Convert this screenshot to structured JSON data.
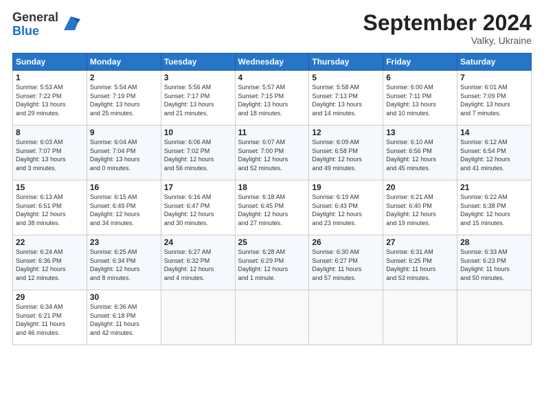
{
  "header": {
    "logo_general": "General",
    "logo_blue": "Blue",
    "month_title": "September 2024",
    "location": "Valky, Ukraine"
  },
  "days_of_week": [
    "Sunday",
    "Monday",
    "Tuesday",
    "Wednesday",
    "Thursday",
    "Friday",
    "Saturday"
  ],
  "weeks": [
    [
      {
        "day": "1",
        "info": "Sunrise: 5:53 AM\nSunset: 7:22 PM\nDaylight: 13 hours\nand 29 minutes."
      },
      {
        "day": "2",
        "info": "Sunrise: 5:54 AM\nSunset: 7:19 PM\nDaylight: 13 hours\nand 25 minutes."
      },
      {
        "day": "3",
        "info": "Sunrise: 5:56 AM\nSunset: 7:17 PM\nDaylight: 13 hours\nand 21 minutes."
      },
      {
        "day": "4",
        "info": "Sunrise: 5:57 AM\nSunset: 7:15 PM\nDaylight: 13 hours\nand 18 minutes."
      },
      {
        "day": "5",
        "info": "Sunrise: 5:58 AM\nSunset: 7:13 PM\nDaylight: 13 hours\nand 14 minutes."
      },
      {
        "day": "6",
        "info": "Sunrise: 6:00 AM\nSunset: 7:11 PM\nDaylight: 13 hours\nand 10 minutes."
      },
      {
        "day": "7",
        "info": "Sunrise: 6:01 AM\nSunset: 7:09 PM\nDaylight: 13 hours\nand 7 minutes."
      }
    ],
    [
      {
        "day": "8",
        "info": "Sunrise: 6:03 AM\nSunset: 7:07 PM\nDaylight: 13 hours\nand 3 minutes."
      },
      {
        "day": "9",
        "info": "Sunrise: 6:04 AM\nSunset: 7:04 PM\nDaylight: 13 hours\nand 0 minutes."
      },
      {
        "day": "10",
        "info": "Sunrise: 6:06 AM\nSunset: 7:02 PM\nDaylight: 12 hours\nand 56 minutes."
      },
      {
        "day": "11",
        "info": "Sunrise: 6:07 AM\nSunset: 7:00 PM\nDaylight: 12 hours\nand 52 minutes."
      },
      {
        "day": "12",
        "info": "Sunrise: 6:09 AM\nSunset: 6:58 PM\nDaylight: 12 hours\nand 49 minutes."
      },
      {
        "day": "13",
        "info": "Sunrise: 6:10 AM\nSunset: 6:56 PM\nDaylight: 12 hours\nand 45 minutes."
      },
      {
        "day": "14",
        "info": "Sunrise: 6:12 AM\nSunset: 6:54 PM\nDaylight: 12 hours\nand 41 minutes."
      }
    ],
    [
      {
        "day": "15",
        "info": "Sunrise: 6:13 AM\nSunset: 6:51 PM\nDaylight: 12 hours\nand 38 minutes."
      },
      {
        "day": "16",
        "info": "Sunrise: 6:15 AM\nSunset: 6:49 PM\nDaylight: 12 hours\nand 34 minutes."
      },
      {
        "day": "17",
        "info": "Sunrise: 6:16 AM\nSunset: 6:47 PM\nDaylight: 12 hours\nand 30 minutes."
      },
      {
        "day": "18",
        "info": "Sunrise: 6:18 AM\nSunset: 6:45 PM\nDaylight: 12 hours\nand 27 minutes."
      },
      {
        "day": "19",
        "info": "Sunrise: 6:19 AM\nSunset: 6:43 PM\nDaylight: 12 hours\nand 23 minutes."
      },
      {
        "day": "20",
        "info": "Sunrise: 6:21 AM\nSunset: 6:40 PM\nDaylight: 12 hours\nand 19 minutes."
      },
      {
        "day": "21",
        "info": "Sunrise: 6:22 AM\nSunset: 6:38 PM\nDaylight: 12 hours\nand 15 minutes."
      }
    ],
    [
      {
        "day": "22",
        "info": "Sunrise: 6:24 AM\nSunset: 6:36 PM\nDaylight: 12 hours\nand 12 minutes."
      },
      {
        "day": "23",
        "info": "Sunrise: 6:25 AM\nSunset: 6:34 PM\nDaylight: 12 hours\nand 8 minutes."
      },
      {
        "day": "24",
        "info": "Sunrise: 6:27 AM\nSunset: 6:32 PM\nDaylight: 12 hours\nand 4 minutes."
      },
      {
        "day": "25",
        "info": "Sunrise: 6:28 AM\nSunset: 6:29 PM\nDaylight: 12 hours\nand 1 minute."
      },
      {
        "day": "26",
        "info": "Sunrise: 6:30 AM\nSunset: 6:27 PM\nDaylight: 11 hours\nand 57 minutes."
      },
      {
        "day": "27",
        "info": "Sunrise: 6:31 AM\nSunset: 6:25 PM\nDaylight: 11 hours\nand 53 minutes."
      },
      {
        "day": "28",
        "info": "Sunrise: 6:33 AM\nSunset: 6:23 PM\nDaylight: 11 hours\nand 50 minutes."
      }
    ],
    [
      {
        "day": "29",
        "info": "Sunrise: 6:34 AM\nSunset: 6:21 PM\nDaylight: 11 hours\nand 46 minutes."
      },
      {
        "day": "30",
        "info": "Sunrise: 6:36 AM\nSunset: 6:18 PM\nDaylight: 11 hours\nand 42 minutes."
      },
      {
        "day": "",
        "info": ""
      },
      {
        "day": "",
        "info": ""
      },
      {
        "day": "",
        "info": ""
      },
      {
        "day": "",
        "info": ""
      },
      {
        "day": "",
        "info": ""
      }
    ]
  ]
}
